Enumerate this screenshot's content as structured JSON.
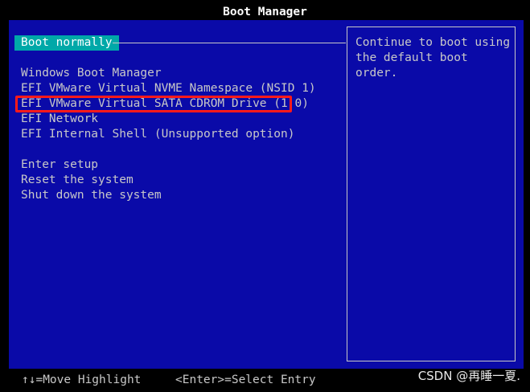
{
  "title": "Boot Manager",
  "default_option": "Boot normally",
  "help_text": "Continue to boot using the default boot order.",
  "boot_entries": [
    "Windows Boot Manager",
    "EFI VMware Virtual NVME Namespace (NSID 1)",
    "EFI VMware Virtual SATA CDROM Drive (1.0)",
    "EFI Network",
    "EFI Internal Shell (Unsupported option)"
  ],
  "system_actions": [
    "Enter setup",
    "Reset the system",
    "Shut down the system"
  ],
  "footer": {
    "move_hint": "↑↓=Move Highlight",
    "select_hint": "<Enter>=Select Entry"
  },
  "watermark": "CSDN @再睡一夏.",
  "colors": {
    "panel_background": "#0a0aa8",
    "selected_background": "#00a8a8",
    "text": "#c8c8c8",
    "annotation_box": "#ff1a1a"
  }
}
